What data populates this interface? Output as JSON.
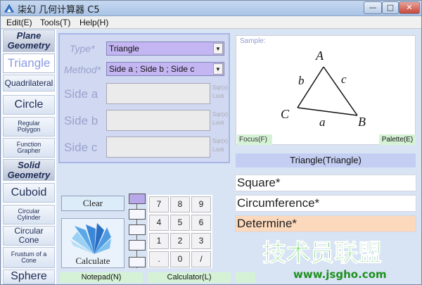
{
  "window": {
    "title": "柒幻 几何计算器 C5",
    "controls": {
      "minimize": "—",
      "maximize": "□",
      "close": "✕"
    }
  },
  "menu": [
    "Edit(E)",
    "Tools(T)",
    "Help(H)"
  ],
  "nav": {
    "plane_header": "Plane Geometry",
    "items_plane": [
      "Triangle",
      "Quadrilateral",
      "Circle",
      "Regular Polygon",
      "Function Grapher"
    ],
    "solid_header": "Solid Geometry",
    "items_solid": [
      "Cuboid",
      "Circular Cylinder",
      "Circular Cone",
      "Frustum of a Cone",
      "Sphere"
    ],
    "selected": "Triangle"
  },
  "inputs": {
    "type_label": "Type*",
    "type_value": "Triangle",
    "method_label": "Method*",
    "method_value": "Side a ; Side b ; Side c",
    "fields": [
      {
        "label": "Side a",
        "value": "",
        "sqr": "Sqr(x)",
        "lock": "Lock"
      },
      {
        "label": "Side b",
        "value": "",
        "sqr": "Sqr(x)",
        "lock": "Lock"
      },
      {
        "label": "Side c",
        "value": "",
        "sqr": "Sqr(x)",
        "lock": "Lock"
      }
    ]
  },
  "sample": {
    "label": "Sample:",
    "vertices": [
      "A",
      "B",
      "C"
    ],
    "sides": [
      "a",
      "b",
      "c"
    ],
    "focus": "Focus(F)",
    "palette": "Palette(E)"
  },
  "shape_title": "Triangle(Triangle)",
  "results": [
    "Square*",
    "Circumference*",
    "Determine*"
  ],
  "buttons": {
    "clear": "Clear",
    "calculate": "Calculate"
  },
  "keypad": [
    "7",
    "8",
    "9",
    "4",
    "5",
    "6",
    "1",
    "2",
    "3",
    ".",
    "0",
    "/"
  ],
  "bottom": {
    "notepad": "Notepad(N)",
    "calculator": "Calculator(L)"
  },
  "watermark": {
    "text": "技术员联盟",
    "url": "www.jsgho.com"
  },
  "colors": {
    "window_bg": "#d8e4f4",
    "panel_bg": "#d0d8f2",
    "select_bg": "#c4b6f2",
    "determine_bg": "#fcd8bc",
    "green_btn": "#d6f2d6",
    "watermark_green": "#2fc02f"
  }
}
